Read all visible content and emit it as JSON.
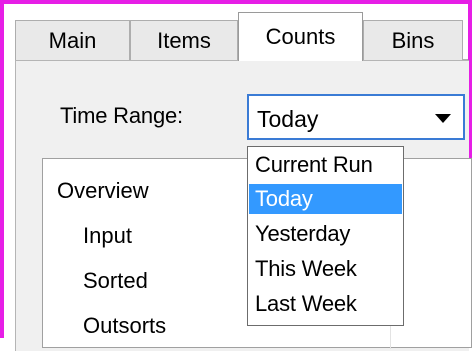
{
  "tabs": [
    {
      "label": "Main"
    },
    {
      "label": "Items"
    },
    {
      "label": "Counts",
      "active": true
    },
    {
      "label": "Bins"
    }
  ],
  "time_range": {
    "label": "Time Range:",
    "selected": "Today",
    "options": [
      "Current Run",
      "Today",
      "Yesterday",
      "This Week",
      "Last Week"
    ]
  },
  "overview": {
    "items": [
      "Overview",
      "Input",
      "Sorted",
      "Outsorts"
    ]
  },
  "colors": {
    "frame": "#e61ee6",
    "selection": "#3399ff",
    "combo_border": "#3a7bd5"
  }
}
